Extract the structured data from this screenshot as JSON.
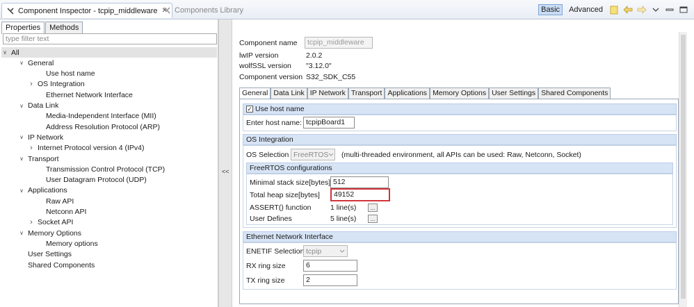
{
  "window": {
    "active_tab_label": "Component Inspector - tcpip_middleware",
    "inactive_tab_label": "Components Library",
    "modes": [
      "Basic",
      "Advanced"
    ]
  },
  "left": {
    "tabs": [
      "Properties",
      "Methods"
    ],
    "filter_placeholder": "type filter text",
    "tree": [
      {
        "label": "All",
        "depth": 0,
        "twisty": "open",
        "selected": true
      },
      {
        "label": "General",
        "depth": 1,
        "twisty": "open"
      },
      {
        "label": "Use host name",
        "depth": 3,
        "twisty": ""
      },
      {
        "label": "OS Integration",
        "depth": 2,
        "twisty": "closed"
      },
      {
        "label": "Ethernet Network Interface",
        "depth": 3,
        "twisty": ""
      },
      {
        "label": "Data Link",
        "depth": 1,
        "twisty": "open"
      },
      {
        "label": "Media-Independent Interface (MII)",
        "depth": 3,
        "twisty": ""
      },
      {
        "label": "Address Resolution Protocol (ARP)",
        "depth": 3,
        "twisty": ""
      },
      {
        "label": "IP Network",
        "depth": 1,
        "twisty": "open"
      },
      {
        "label": "Internet Protocol version 4 (IPv4)",
        "depth": 2,
        "twisty": "closed"
      },
      {
        "label": "Transport",
        "depth": 1,
        "twisty": "open"
      },
      {
        "label": "Transmission Control Protocol (TCP)",
        "depth": 3,
        "twisty": ""
      },
      {
        "label": "User Datagram Protocol (UDP)",
        "depth": 3,
        "twisty": ""
      },
      {
        "label": "Applications",
        "depth": 1,
        "twisty": "open"
      },
      {
        "label": "Raw API",
        "depth": 3,
        "twisty": ""
      },
      {
        "label": "Netconn API",
        "depth": 3,
        "twisty": ""
      },
      {
        "label": "Socket API",
        "depth": 2,
        "twisty": "closed"
      },
      {
        "label": "Memory Options",
        "depth": 1,
        "twisty": "open"
      },
      {
        "label": "Memory options",
        "depth": 3,
        "twisty": ""
      },
      {
        "label": "User Settings",
        "depth": 1,
        "twisty": ""
      },
      {
        "label": "Shared Components",
        "depth": 1,
        "twisty": ""
      }
    ]
  },
  "divider": {
    "collapse_label": "<<"
  },
  "right": {
    "component_name_label": "Component name",
    "component_name_value": "tcpip_middleware",
    "lwip_label": "lwIP version",
    "lwip_value": "2.0.2",
    "wolfssl_label": "wolfSSL version",
    "wolfssl_value": "\"3.12.0\"",
    "component_version_label": "Component version",
    "component_version_value": "S32_SDK_C55",
    "tabs": [
      "General",
      "Data Link",
      "IP Network",
      "Transport",
      "Applications",
      "Memory Options",
      "User Settings",
      "Shared Components"
    ],
    "use_host_name": {
      "label": "Use host name",
      "checked": true,
      "enter_label": "Enter host name:",
      "value": "tcpipBoard1"
    },
    "os_integration": {
      "header": "OS Integration",
      "selection_label": "OS Selection",
      "selection_value": "FreeRTOS",
      "selection_note": "(multi-threaded environment, all APIs can be used: Raw, Netconn, Socket)",
      "freertos_header": "FreeRTOS configurations",
      "min_stack_label": "Minimal stack size[bytes]",
      "min_stack_value": "512",
      "heap_label": "Total heap size[bytes]",
      "heap_value": "49152",
      "assert_label": "ASSERT() function",
      "assert_value": "1 line(s)",
      "user_defines_label": "User Defines",
      "user_defines_value": "5 line(s)",
      "dots_label": "..."
    },
    "ethernet": {
      "header": "Ethernet Network Interface",
      "enetif_label": "ENETIF Selection",
      "enetif_value": "tcpip",
      "rx_label": "RX ring size",
      "rx_value": "6",
      "tx_label": "TX ring size",
      "tx_value": "2"
    }
  },
  "colors": {
    "highlight": "#d0343a",
    "section_header": "#d7e4f5"
  }
}
